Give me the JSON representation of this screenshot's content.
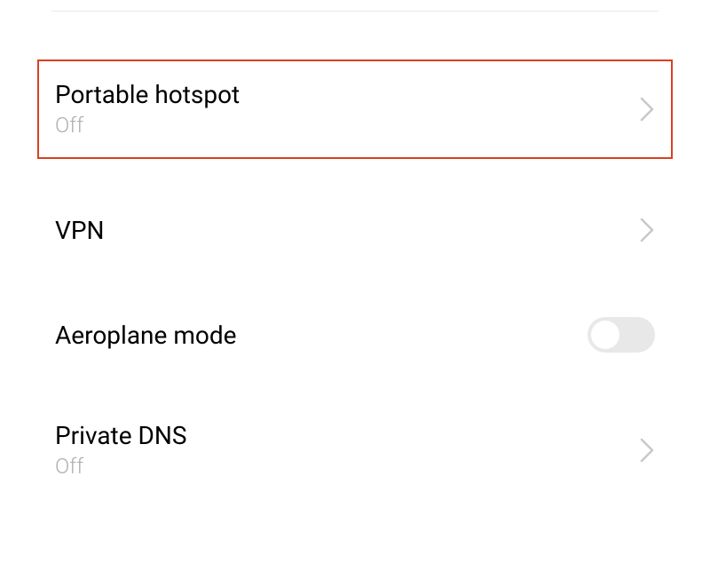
{
  "settings": {
    "portable_hotspot": {
      "title": "Portable hotspot",
      "subtitle": "Off"
    },
    "vpn": {
      "title": "VPN"
    },
    "aeroplane_mode": {
      "title": "Aeroplane mode",
      "enabled": false
    },
    "private_dns": {
      "title": "Private DNS",
      "subtitle": "Off"
    }
  },
  "colors": {
    "highlight_border": "#d94020",
    "subtitle_text": "#b0b0b0",
    "toggle_bg": "#e8e8e8"
  }
}
